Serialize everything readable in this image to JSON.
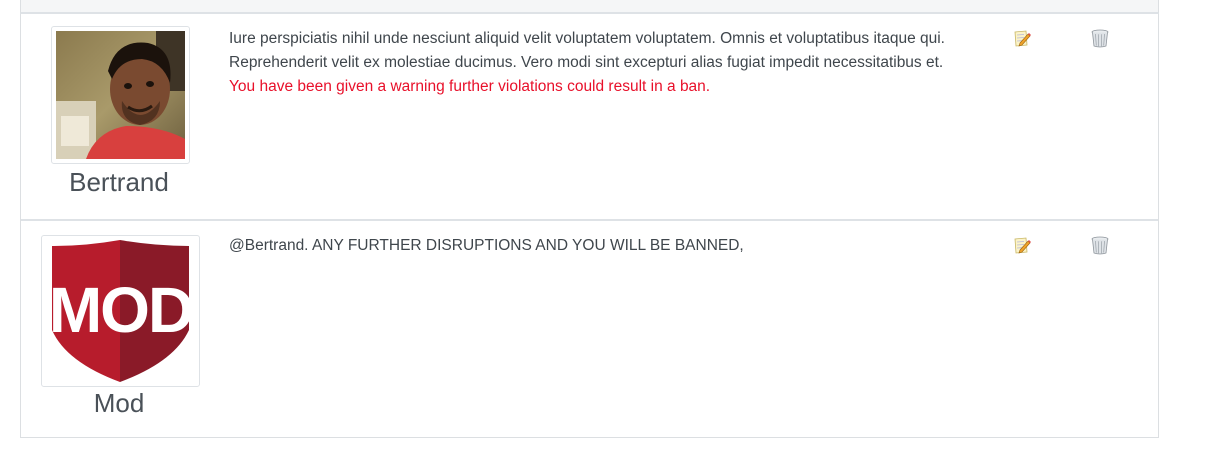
{
  "comments": [
    {
      "username": "Bertrand",
      "avatar_icon": "user-photo",
      "text": "Iure perspiciatis nihil unde nesciunt aliquid velit voluptatem voluptatem. Omnis et voluptatibus itaque qui. Reprehenderit velit ex molestiae ducimus. Vero modi sint excepturi alias fugiat impedit necessitatibus et.",
      "warning": "You have been given a warning further violations could result in a ban.",
      "edit_icon": "edit-icon",
      "delete_icon": "trash-icon"
    },
    {
      "username": "Mod",
      "avatar_icon": "mod-shield-logo",
      "avatar_logo_text": "MOD",
      "text": "@Bertrand. ANY FURTHER DISRUPTIONS AND YOU WILL BE BANNED,",
      "edit_icon": "edit-icon",
      "delete_icon": "trash-icon"
    }
  ],
  "colors": {
    "warning": "#e8102a",
    "mod_shield_light": "#b71c2c",
    "mod_shield_dark": "#8a1a28",
    "border": "#dee2e6"
  }
}
